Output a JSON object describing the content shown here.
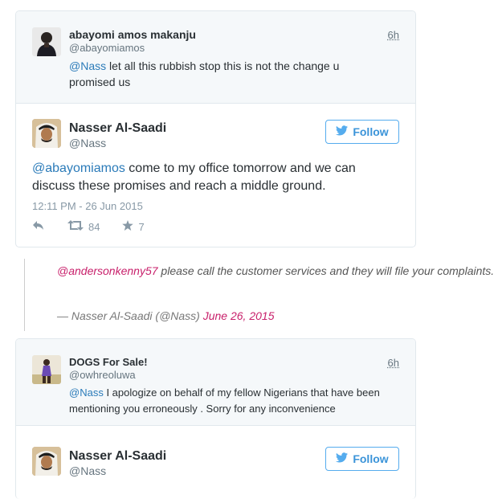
{
  "card1": {
    "reply": {
      "name": "abayomi amos makanju",
      "handle": "@abayomiamos",
      "time": "6h",
      "mention": "@Nass",
      "text": " let all this rubbish stop this is not the change u promised us"
    },
    "tweet": {
      "name": "Nasser Al-Saadi",
      "handle": "@Nass",
      "follow_label": "Follow",
      "mention": "@abayomiamos",
      "text": " come to my office tomorrow and we can discuss these promises and reach a middle ground.",
      "date": "12:11 PM - 26 Jun 2015",
      "retweets": "84",
      "favorites": "7"
    }
  },
  "quote": {
    "mention": "@andersonkenny57",
    "text": " please call the customer services and they will file your complaints.",
    "attribution": "— Nasser Al-Saadi (@Nass) ",
    "date": "June 26, 2015"
  },
  "card2": {
    "reply": {
      "name": "DOGS For Sale!",
      "handle": "@owhreoluwa",
      "time": "6h",
      "mention": "@Nass",
      "text": " I apologize on behalf of my fellow Nigerians that have been mentioning you erroneously . Sorry for any inconvenience"
    },
    "tweet": {
      "name": "Nasser Al-Saadi",
      "handle": "@Nass",
      "follow_label": "Follow"
    }
  },
  "colors": {
    "link": "#2b7bb9",
    "quote_link": "#c8206b",
    "follow": "#3b94d9"
  }
}
